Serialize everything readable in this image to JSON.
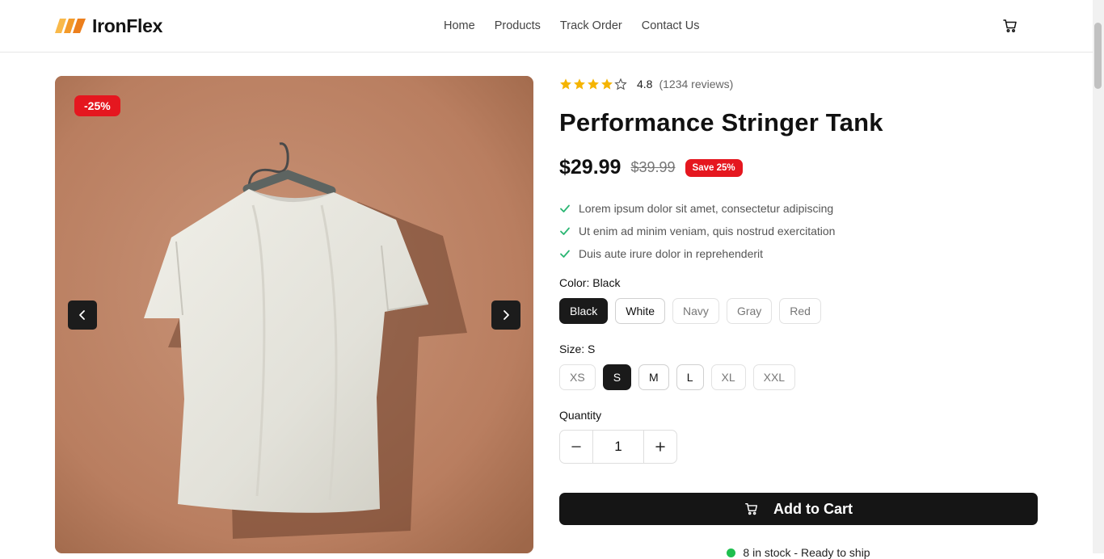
{
  "brand": {
    "name": "IronFlex"
  },
  "nav": {
    "items": [
      "Home",
      "Products",
      "Track Order",
      "Contact Us"
    ]
  },
  "product": {
    "discount_badge": "-25%",
    "rating": {
      "stars": 4,
      "max": 5,
      "value": "4.8",
      "count": "(1234 reviews)"
    },
    "title": "Performance Stringer Tank",
    "price": "$29.99",
    "old_price": "$39.99",
    "save_badge": "Save 25%",
    "features": [
      "Lorem ipsum dolor sit amet, consectetur adipiscing",
      "Ut enim ad minim veniam, quis nostrud exercitation",
      "Duis aute irure dolor in reprehenderit"
    ],
    "color": {
      "label": "Color: Black",
      "options": [
        "Black",
        "White",
        "Navy",
        "Gray",
        "Red"
      ],
      "selected": "Black"
    },
    "size": {
      "label": "Size: S",
      "options": [
        "XS",
        "S",
        "M",
        "L",
        "XL",
        "XXL"
      ],
      "selected": "S"
    },
    "quantity": {
      "label": "Quantity",
      "value": "1"
    },
    "add_to_cart": "Add to Cart",
    "stock": "8 in stock - Ready to ship"
  },
  "icons": {
    "cart": "cart-icon",
    "star": "star-icon",
    "check": "check-icon",
    "prev": "chevron-left-icon",
    "next": "chevron-right-icon",
    "minus": "minus-icon",
    "plus": "plus-icon"
  },
  "colors": {
    "accent_red": "#e5171f",
    "star_gold": "#f5b400",
    "check_green": "#2bb673",
    "stock_green": "#1fbf4f",
    "logo_orange": "#f5a623",
    "dark": "#151515"
  }
}
